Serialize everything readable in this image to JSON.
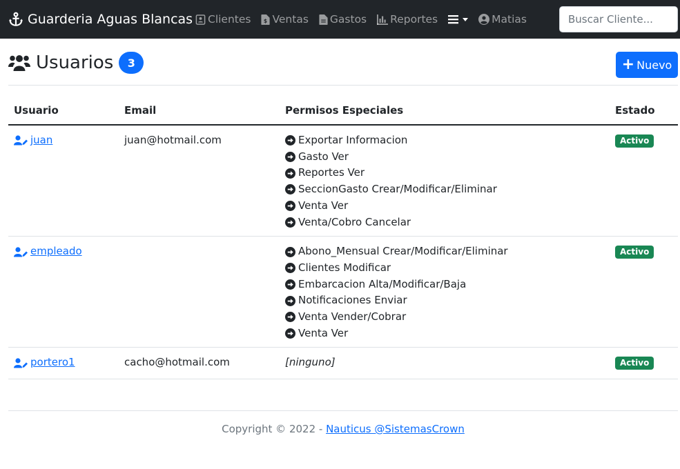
{
  "navbar": {
    "brand": "Guarderia Aguas Blancas",
    "links": [
      {
        "label": "Clientes",
        "icon": "address-card-icon"
      },
      {
        "label": "Ventas",
        "icon": "file-invoice-icon"
      },
      {
        "label": "Gastos",
        "icon": "file-icon"
      },
      {
        "label": "Reportes",
        "icon": "chart-bar-icon"
      }
    ],
    "user": "Matias",
    "search_placeholder": "Buscar Cliente..."
  },
  "header": {
    "title": "Usuarios",
    "count": "3",
    "new_button": "Nuevo"
  },
  "table": {
    "columns": [
      "Usuario",
      "Email",
      "Permisos Especiales",
      "Estado"
    ],
    "rows": [
      {
        "user": "juan",
        "email": "juan@hotmail.com",
        "permissions": [
          "Exportar Informacion",
          "Gasto Ver",
          "Reportes Ver",
          "SeccionGasto Crear/Modificar/Eliminar",
          "Venta Ver",
          "Venta/Cobro Cancelar"
        ],
        "status": "Activo"
      },
      {
        "user": "empleado",
        "email": "",
        "permissions": [
          "Abono_Mensual Crear/Modificar/Eliminar",
          "Clientes Modificar",
          "Embarcacion Alta/Modificar/Baja",
          "Notificaciones Enviar",
          "Venta Vender/Cobrar",
          "Venta Ver"
        ],
        "status": "Activo"
      },
      {
        "user": "portero1",
        "email": "cacho@hotmail.com",
        "permissions": [],
        "none_label": "[ninguno]",
        "status": "Activo"
      }
    ]
  },
  "footer": {
    "text": "Copyright © 2022 - ",
    "link": "Nauticus @SistemasCrown"
  },
  "colors": {
    "navbar_bg": "#212529",
    "primary": "#0d6efd",
    "success": "#198754"
  }
}
